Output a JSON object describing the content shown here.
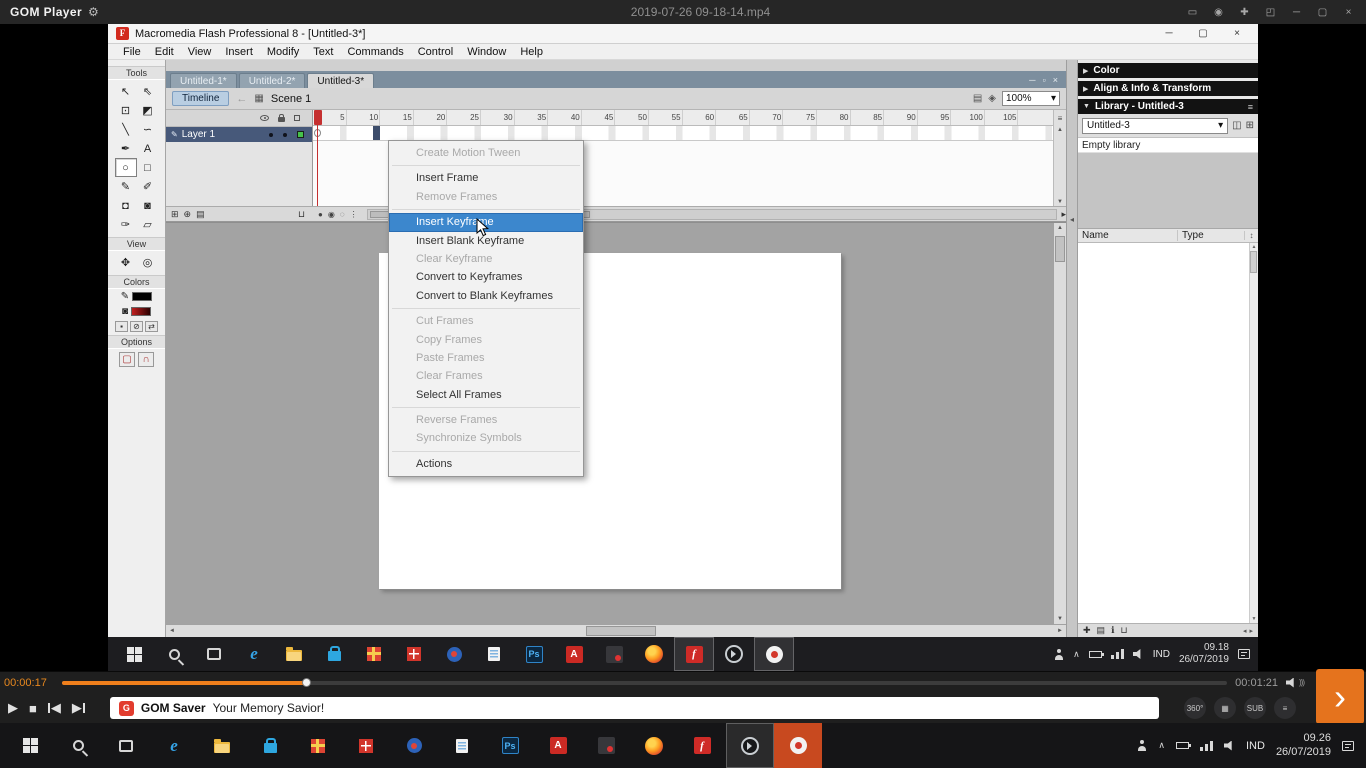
{
  "gom": {
    "title": {
      "app": "GOM Player",
      "filename": "2019-07-26 09-18-14.mp4",
      "gear": "⚙"
    },
    "window_buttons": [
      {
        "name": "panel-toggle-button",
        "glyph": "▭"
      },
      {
        "name": "ratio-button",
        "glyph": "◉"
      },
      {
        "name": "open-file-button",
        "glyph": "✚"
      },
      {
        "name": "fullscreen-button",
        "glyph": "◰"
      },
      {
        "name": "minimize-button",
        "glyph": "─"
      },
      {
        "name": "maximize-button",
        "glyph": "▢"
      },
      {
        "name": "close-button",
        "glyph": "×"
      }
    ],
    "controls": {
      "current_time": "00:00:17",
      "duration": "00:01:21",
      "progress_percent": 21,
      "wave": ")))",
      "next_chevron": "›",
      "transport": {
        "play": "▶",
        "stop": "■",
        "prev": "◀",
        "next": "▶"
      },
      "banner": {
        "icon_letter": "G",
        "brand": "GOM Saver",
        "tagline": "Your Memory Savior!"
      },
      "badges": [
        {
          "name": "view-360-button",
          "label": "360°"
        },
        {
          "name": "capture-button",
          "label": "▦"
        },
        {
          "name": "subtitle-button",
          "label": "SUB"
        },
        {
          "name": "control-settings-button",
          "label": "≡"
        }
      ]
    }
  },
  "flash": {
    "title": "Macromedia Flash Professional 8 - [Untitled-3*]",
    "app_initial": "F",
    "window_buttons": [
      {
        "name": "flash-minimize-button",
        "glyph": "─"
      },
      {
        "name": "flash-maximize-button",
        "glyph": "▢"
      },
      {
        "name": "flash-close-button",
        "glyph": "×"
      }
    ],
    "menu": [
      "File",
      "Edit",
      "View",
      "Insert",
      "Modify",
      "Text",
      "Commands",
      "Control",
      "Window",
      "Help"
    ],
    "tabs": [
      {
        "label": "Untitled-1*",
        "active": false
      },
      {
        "label": "Untitled-2*",
        "active": false
      },
      {
        "label": "Untitled-3*",
        "active": true
      }
    ],
    "tab_buttons": [
      {
        "name": "doc-minimize-button",
        "glyph": "─"
      },
      {
        "name": "doc-restore-button",
        "glyph": "▫"
      },
      {
        "name": "doc-close-button",
        "glyph": "×"
      }
    ],
    "edit_bar": {
      "timeline_button": "Timeline",
      "back": "←",
      "clapper": "▦",
      "scene": "Scene 1",
      "edit_scene": "▤",
      "edit_symbols": "◈",
      "zoom": "100%",
      "dropdown": "▾"
    },
    "tools_panel": {
      "labels": {
        "tools": "Tools",
        "view": "View",
        "colors": "Colors",
        "options": "Options"
      },
      "tools": [
        {
          "name": "selection-tool",
          "glyph": "↖"
        },
        {
          "name": "subselection-tool",
          "glyph": "⇖"
        },
        {
          "name": "free-transform-tool",
          "glyph": "⊡"
        },
        {
          "name": "gradient-transform-tool",
          "glyph": "◩"
        },
        {
          "name": "line-tool",
          "glyph": "╲"
        },
        {
          "name": "lasso-tool",
          "glyph": "∽"
        },
        {
          "name": "pen-tool",
          "glyph": "✒"
        },
        {
          "name": "text-tool",
          "glyph": "A"
        },
        {
          "name": "oval-tool",
          "glyph": "○",
          "selected": true
        },
        {
          "name": "rectangle-tool",
          "glyph": "□"
        },
        {
          "name": "pencil-tool",
          "glyph": "✎"
        },
        {
          "name": "brush-tool",
          "glyph": "✐"
        },
        {
          "name": "ink-bottle-tool",
          "glyph": "◘"
        },
        {
          "name": "paint-bucket-tool",
          "glyph": "◙"
        },
        {
          "name": "eyedropper-tool",
          "glyph": "✑"
        },
        {
          "name": "eraser-tool",
          "glyph": "▱"
        }
      ],
      "view_tools": [
        {
          "name": "hand-tool",
          "glyph": "✥"
        },
        {
          "name": "zoom-tool",
          "glyph": "◎"
        }
      ],
      "colors": {
        "stroke_glyph": "✎",
        "fill_glyph": "◙",
        "mini_buttons": [
          "▪",
          "⊘",
          "⇄"
        ],
        "option_buttons": [
          "▢",
          "∩"
        ]
      }
    },
    "timeline": {
      "layer_name": "Layer 1",
      "ruler": [
        "5",
        "10",
        "15",
        "20",
        "25",
        "30",
        "35",
        "40",
        "45",
        "50",
        "55",
        "60",
        "65",
        "70",
        "75",
        "80",
        "85",
        "90",
        "95",
        "100",
        "105"
      ],
      "icons": {
        "pencil": "✎",
        "insert_layer": "⊞",
        "motion_guide": "⊕",
        "insert_folder": "▤",
        "delete_layer": "⊔",
        "onion": [
          "●",
          "◉",
          "◌",
          "⋮"
        ],
        "menu": "≡"
      }
    },
    "context_menu": {
      "items": [
        {
          "label": "Create Motion Tween",
          "enabled": false
        },
        {
          "sep": true
        },
        {
          "label": "Insert Frame",
          "enabled": true
        },
        {
          "label": "Remove Frames",
          "enabled": false
        },
        {
          "sep": true
        },
        {
          "label": "Insert Keyframe",
          "enabled": true,
          "highlighted": true
        },
        {
          "label": "Insert Blank Keyframe",
          "enabled": true
        },
        {
          "label": "Clear Keyframe",
          "enabled": false
        },
        {
          "label": "Convert to Keyframes",
          "enabled": true
        },
        {
          "label": "Convert to Blank Keyframes",
          "enabled": true
        },
        {
          "sep": true
        },
        {
          "label": "Cut Frames",
          "enabled": false
        },
        {
          "label": "Copy Frames",
          "enabled": false
        },
        {
          "label": "Paste Frames",
          "enabled": false
        },
        {
          "label": "Clear Frames",
          "enabled": false
        },
        {
          "label": "Select All Frames",
          "enabled": true
        },
        {
          "sep": true
        },
        {
          "label": "Reverse Frames",
          "enabled": false
        },
        {
          "label": "Synchronize Symbols",
          "enabled": false
        },
        {
          "sep": true
        },
        {
          "label": "Actions",
          "enabled": true
        }
      ]
    },
    "panels": {
      "color_header": "Color",
      "align_header": "Align & Info & Transform",
      "library_header": "Library - Untitled-3",
      "library_select": "Untitled-3",
      "empty_text": "Empty library",
      "columns": [
        "Name",
        "Type"
      ],
      "icons": {
        "collapsed": "▶",
        "expanded": "▼",
        "menu": "≡",
        "pin": "◫",
        "new_panel": "⊞",
        "dropdown": "▾",
        "sort": "↕",
        "new_item": "✚",
        "folder": "▤",
        "properties": "ℹ",
        "trash": "⊔"
      }
    }
  },
  "glyphs": {
    "up": "▲",
    "down": "▼",
    "left": "◄",
    "right": "►",
    "small_left": "◂",
    "small_right": "▸",
    "chevron_up": "∧",
    "splitter": "◂"
  },
  "taskbar_icons": [
    {
      "name": "start"
    },
    {
      "name": "search"
    },
    {
      "name": "task-view"
    },
    {
      "name": "edge",
      "glyph": "e"
    },
    {
      "name": "file-explorer"
    },
    {
      "name": "store"
    },
    {
      "name": "gift-app"
    },
    {
      "name": "grid-app"
    },
    {
      "name": "badge-app"
    },
    {
      "name": "notes-app"
    },
    {
      "name": "photoshop",
      "glyph": "Ps"
    },
    {
      "name": "adobe-app",
      "glyph": "A"
    },
    {
      "name": "media-app"
    },
    {
      "name": "firefox"
    },
    {
      "name": "flash",
      "glyph": "f"
    },
    {
      "name": "gom-player"
    },
    {
      "name": "gom-cam"
    }
  ],
  "video_taskbar": {
    "active": [
      "flash",
      "gom-cam"
    ],
    "tray": {
      "lang": "IND",
      "time": "09.18",
      "date": "26/07/2019"
    }
  },
  "system_taskbar": {
    "active": [
      "gom-player"
    ],
    "recording": "gom-cam",
    "tray": {
      "lang": "IND",
      "time": "09.26",
      "date": "26/07/2019"
    }
  }
}
